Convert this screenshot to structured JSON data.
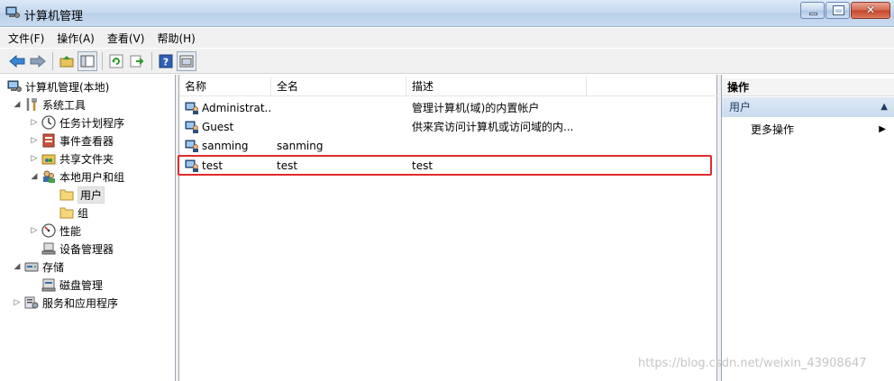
{
  "window": {
    "title": "计算机管理"
  },
  "menu": [
    "文件(F)",
    "操作(A)",
    "查看(V)",
    "帮助(H)"
  ],
  "tree": [
    {
      "label": "计算机管理(本地)",
      "icon": "computer-management-icon",
      "expander": ""
    },
    {
      "label": "系统工具",
      "icon": "tools-icon",
      "expander": "◢"
    },
    {
      "label": "任务计划程序",
      "icon": "clock-icon",
      "expander": "▷"
    },
    {
      "label": "事件查看器",
      "icon": "event-viewer-icon",
      "expander": "▷"
    },
    {
      "label": "共享文件夹",
      "icon": "shared-folder-icon",
      "expander": "▷"
    },
    {
      "label": "本地用户和组",
      "icon": "users-group-icon",
      "expander": "◢"
    },
    {
      "label": "用户",
      "icon": "folder-icon",
      "expander": ""
    },
    {
      "label": "组",
      "icon": "folder-icon",
      "expander": ""
    },
    {
      "label": "性能",
      "icon": "performance-icon",
      "expander": "▷"
    },
    {
      "label": "设备管理器",
      "icon": "device-manager-icon",
      "expander": ""
    },
    {
      "label": "存储",
      "icon": "storage-icon",
      "expander": "◢"
    },
    {
      "label": "磁盘管理",
      "icon": "disk-management-icon",
      "expander": ""
    },
    {
      "label": "服务和应用程序",
      "icon": "services-icon",
      "expander": "▷"
    }
  ],
  "list": {
    "columns": [
      "名称",
      "全名",
      "描述"
    ],
    "rows": [
      {
        "name": "Administrat...",
        "fullname": "",
        "desc": "管理计算机(域)的内置帐户"
      },
      {
        "name": "Guest",
        "fullname": "",
        "desc": "供来宾访问计算机或访问域的内..."
      },
      {
        "name": "sanming",
        "fullname": "sanming",
        "desc": ""
      },
      {
        "name": "test",
        "fullname": "test",
        "desc": "test"
      }
    ]
  },
  "actions": {
    "header": "操作",
    "section": "用户",
    "item": "更多操作"
  },
  "watermark": "https://blog.csdn.net/weixin_43908647",
  "colors": {
    "highlight": "#e12b2b",
    "section_bg": "#c9dbef"
  }
}
